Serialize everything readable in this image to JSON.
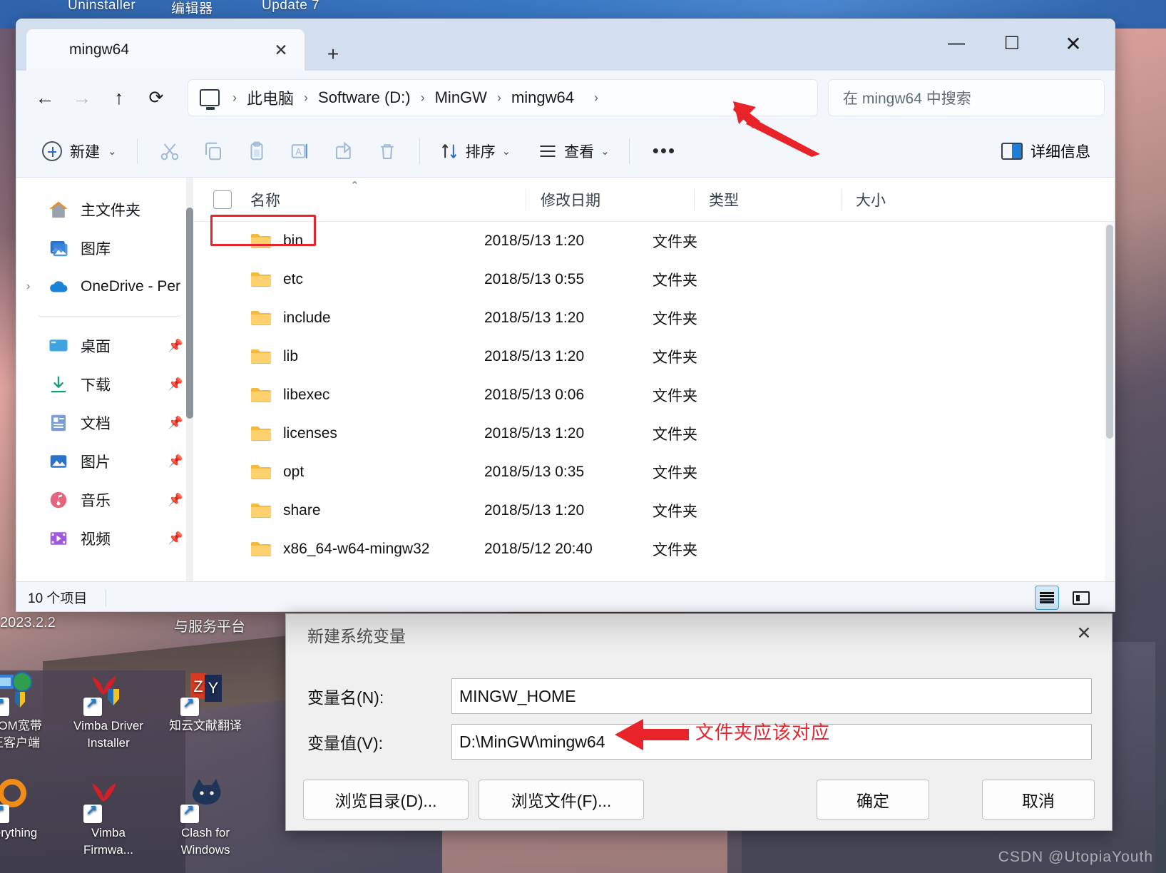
{
  "desktop": {
    "top_labels": [
      "Uninstaller",
      "编辑器",
      "Update 7"
    ],
    "left_texts": [
      "2023.2.2",
      "与服务平台"
    ],
    "icons": [
      {
        "name": "COM宽带\n正客户端",
        "line1": "COM宽带",
        "line2": "正客户端",
        "icon": "network-shield-icon"
      },
      {
        "name": "Vimba Driver Installer",
        "line1": "Vimba Driver",
        "line2": "Installer",
        "icon": "vimba-icon"
      },
      {
        "name": "知云文献翻译",
        "line1": "知云文献翻译",
        "line2": "",
        "icon": "zhiyun-icon"
      },
      {
        "name": "Everything",
        "line1": "erything",
        "line2": "",
        "icon": "everything-icon"
      },
      {
        "name": "Vimba Firmwa...",
        "line1": "Vimba",
        "line2": "Firmwa...",
        "icon": "vimba-icon"
      },
      {
        "name": "Clash for Windows",
        "line1": "Clash for",
        "line2": "Windows",
        "icon": "clash-cat-icon"
      }
    ],
    "watermark": "CSDN @UtopiaYouth"
  },
  "explorer": {
    "tab": {
      "title": "mingw64",
      "close_label": "✕"
    },
    "new_tab_label": "+",
    "window_controls": {
      "minimize": "—",
      "maximize": "☐",
      "close": "✕"
    },
    "nav": {
      "back": "←",
      "forward": "→",
      "up": "↑",
      "refresh": "⟳"
    },
    "breadcrumb": {
      "root_icon": "this-pc-icon",
      "items": [
        "此电脑",
        "Software (D:)",
        "MinGW",
        "mingw64"
      ],
      "separator": "›",
      "trailing_separator": "›"
    },
    "search": {
      "placeholder": "在 mingw64 中搜索"
    },
    "toolbar": {
      "new_label": "新建",
      "new_chevron": "⌄",
      "cut": "cut-icon",
      "copy": "copy-icon",
      "paste": "paste-icon",
      "rename": "rename-icon",
      "share": "share-icon",
      "delete": "delete-icon",
      "sort_label": "排序",
      "sort_chevron": "⌄",
      "view_label": "查看",
      "view_chevron": "⌄",
      "more_label": "•••",
      "details_label": "详细信息"
    },
    "sidebar": {
      "items": [
        {
          "label": "主文件夹",
          "icon": "home-icon",
          "pinned": false,
          "expandable": false
        },
        {
          "label": "图库",
          "icon": "gallery-icon",
          "pinned": false,
          "expandable": false
        },
        {
          "label": "OneDrive - Per",
          "icon": "onedrive-icon",
          "pinned": false,
          "expandable": true,
          "chevron": "›"
        }
      ],
      "pinned_items": [
        {
          "label": "桌面",
          "icon": "desktop-icon",
          "pinned": true
        },
        {
          "label": "下载",
          "icon": "downloads-icon",
          "pinned": true
        },
        {
          "label": "文档",
          "icon": "documents-icon",
          "pinned": true
        },
        {
          "label": "图片",
          "icon": "pictures-icon",
          "pinned": true
        },
        {
          "label": "音乐",
          "icon": "music-icon",
          "pinned": true
        },
        {
          "label": "视频",
          "icon": "videos-icon",
          "pinned": true
        }
      ],
      "pin_glyph": "📌"
    },
    "columns": [
      "名称",
      "修改日期",
      "类型",
      "大小"
    ],
    "sort_caret": "⌃",
    "rows": [
      {
        "name": "bin",
        "modified": "2018/5/13 1:20",
        "type": "文件夹",
        "size": "",
        "highlighted": true
      },
      {
        "name": "etc",
        "modified": "2018/5/13 0:55",
        "type": "文件夹",
        "size": ""
      },
      {
        "name": "include",
        "modified": "2018/5/13 1:20",
        "type": "文件夹",
        "size": ""
      },
      {
        "name": "lib",
        "modified": "2018/5/13 1:20",
        "type": "文件夹",
        "size": ""
      },
      {
        "name": "libexec",
        "modified": "2018/5/13 0:06",
        "type": "文件夹",
        "size": ""
      },
      {
        "name": "licenses",
        "modified": "2018/5/13 1:20",
        "type": "文件夹",
        "size": ""
      },
      {
        "name": "opt",
        "modified": "2018/5/13 0:35",
        "type": "文件夹",
        "size": ""
      },
      {
        "name": "share",
        "modified": "2018/5/13 1:20",
        "type": "文件夹",
        "size": ""
      },
      {
        "name": "x86_64-w64-mingw32",
        "modified": "2018/5/12 20:40",
        "type": "文件夹",
        "size": ""
      }
    ],
    "status": {
      "count_label": "10 个项目"
    }
  },
  "dialog": {
    "title": "新建系统变量",
    "close_label": "✕",
    "name_label": "变量名(N):",
    "name_value": "MINGW_HOME",
    "value_label": "变量值(V):",
    "value_value": "D:\\MinGW\\mingw64",
    "buttons": {
      "browse_dir": "浏览目录(D)...",
      "browse_file": "浏览文件(F)...",
      "ok": "确定",
      "cancel": "取消"
    }
  },
  "annotations": {
    "value_note": "文件夹应该对应",
    "accent_red": "#e8232a"
  }
}
